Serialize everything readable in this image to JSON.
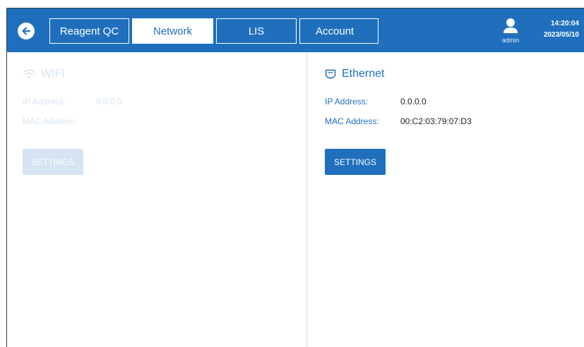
{
  "header": {
    "tabs": [
      {
        "label": "Reagent QC",
        "active": false
      },
      {
        "label": "Network",
        "active": true
      },
      {
        "label": "LIS",
        "active": false
      },
      {
        "label": "Account",
        "active": false
      }
    ],
    "user": {
      "name": "admin",
      "icon": "user-icon"
    },
    "time": "14:20:04",
    "date": "2023/05/10"
  },
  "wifi": {
    "title": "WIFI",
    "icon": "wifi-icon",
    "ip_label": "IP Address:",
    "ip_value": "0.0.0.0",
    "mac_label": "MAC Address:",
    "mac_value": "",
    "settings_label": "SETTINGS",
    "enabled": false
  },
  "ethernet": {
    "title": "Ethernet",
    "icon": "ethernet-icon",
    "ip_label": "IP Address:",
    "ip_value": "0.0.0.0",
    "mac_label": "MAC Address:",
    "mac_value": "00:C2:03:79:07:D3",
    "settings_label": "SETTINGS"
  },
  "colors": {
    "primary": "#1f6fbd",
    "background": "#ffffff"
  }
}
